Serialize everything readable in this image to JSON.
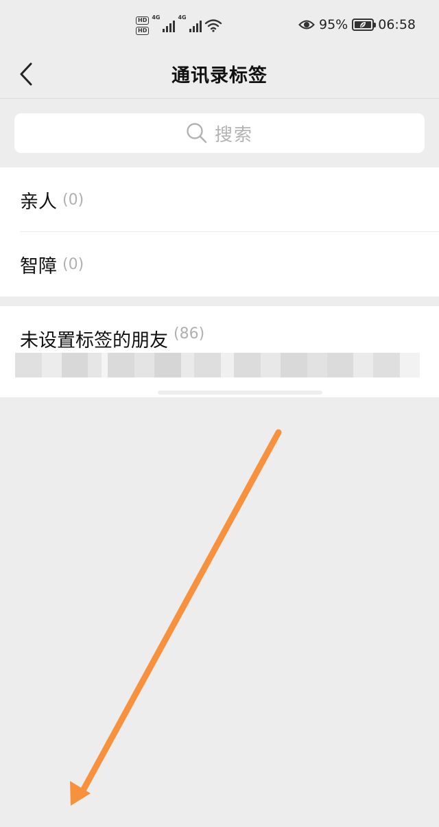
{
  "status_bar": {
    "hd1": "HD",
    "hd2": "HD",
    "net1": "4G",
    "net2": "4G",
    "battery_percent": "95%",
    "time": "06:58"
  },
  "nav": {
    "title": "通讯录标签"
  },
  "search": {
    "placeholder": "搜索"
  },
  "tags": [
    {
      "label": "亲人",
      "count": "(0)"
    },
    {
      "label": "智障",
      "count": "(0)"
    }
  ],
  "untagged": {
    "label": "未设置标签的朋友",
    "count": "(86)"
  },
  "colors": {
    "background": "#ededed",
    "card": "#ffffff",
    "arrow": "#f7913d"
  }
}
